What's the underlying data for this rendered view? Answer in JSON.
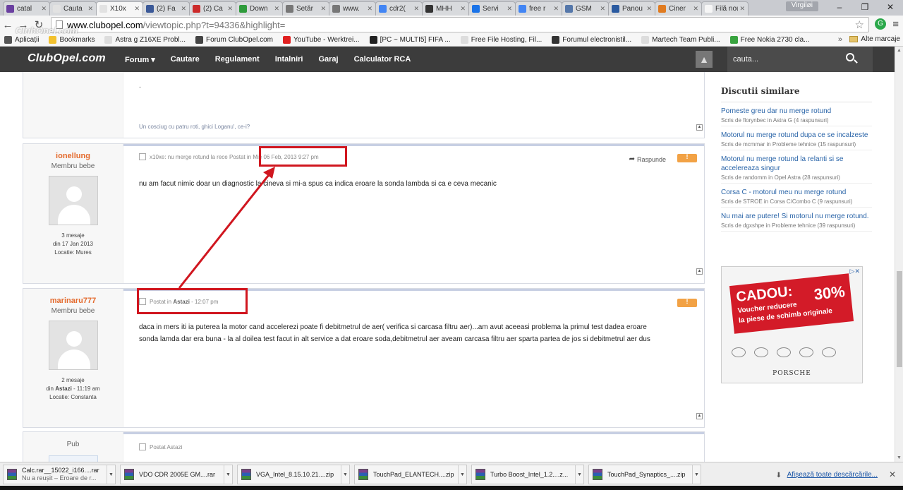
{
  "browser": {
    "tabs": [
      {
        "title": "catal",
        "color": "#6a3fa0"
      },
      {
        "title": "Cauta",
        "color": "#e2e2e2"
      },
      {
        "title": "X10x",
        "color": "#e2e2e2",
        "active": true
      },
      {
        "title": "(2) Fa",
        "color": "#3b5998"
      },
      {
        "title": "(2) Ca",
        "color": "#cc2b2b"
      },
      {
        "title": "Down",
        "color": "#2e9b3b"
      },
      {
        "title": "Setăr",
        "color": "#777777"
      },
      {
        "title": "www.",
        "color": "#777777"
      },
      {
        "title": "cdr2(",
        "color": "#4285f4"
      },
      {
        "title": "MHH",
        "color": "#333333"
      },
      {
        "title": "Servi",
        "color": "#1a73e8"
      },
      {
        "title": "free r",
        "color": "#4285f4"
      },
      {
        "title": "GSM",
        "color": "#5577aa"
      },
      {
        "title": "Panou",
        "color": "#2a5aa0"
      },
      {
        "title": "Ciner",
        "color": "#e07b20"
      },
      {
        "title": "Filă nouă",
        "color": "#f6f6f6"
      }
    ],
    "profile": "Virgiløi",
    "url_host": "www.clubopel.com",
    "url_path": "/viewtopic.php?t=94336&highlight=",
    "watermark": "ClubOpel.com",
    "bookmarks": [
      {
        "label": "Aplicații",
        "color": "#555555"
      },
      {
        "label": "Bookmarks",
        "color": "#f2c12e"
      },
      {
        "label": "Astra g Z16XE Probl...",
        "color": "#dddddd"
      },
      {
        "label": "Forum ClubOpel.com",
        "color": "#444444"
      },
      {
        "label": "YouTube - Werktrei...",
        "color": "#e02020"
      },
      {
        "label": "[PC ~ MULTI5] FIFA ...",
        "color": "#222222"
      },
      {
        "label": "Free File Hosting, Fil...",
        "color": "#dddddd"
      },
      {
        "label": "Forumul electronistil...",
        "color": "#333333"
      },
      {
        "label": "Martech Team Publi...",
        "color": "#dddddd"
      },
      {
        "label": "Free Nokia 2730 cla...",
        "color": "#39a33f"
      }
    ],
    "bookmarks_other": "Alte marcaje"
  },
  "site": {
    "logo": "ClubOpel.com",
    "nav": [
      "Forum ▾",
      "Cautare",
      "Regulament",
      "Intalniri",
      "Garaj",
      "Calculator RCA"
    ],
    "search_placeholder": "cauta..."
  },
  "posts": [
    {
      "text": ".",
      "signature": "Un cosciug cu patru roti, ghici Loganu', ce-i?"
    },
    {
      "username": "ionellung",
      "rank": "Membru bebe",
      "stats": [
        "3 mesaje",
        "din 17 Jan 2013",
        "Locatie: Mures"
      ],
      "meta_prefix": "x10xe: nu merge rotund la rece Postat in",
      "meta_date": "Mie 06 Feb, 2013 9:27 pm",
      "reply_label": "Raspunde",
      "text": "nu am facut nimic doar un diagnostic la cineva si mi-a spus ca indica eroare la sonda lambda si ca e ceva mecanic"
    },
    {
      "username": "marinaru777",
      "rank": "Membru bebe",
      "stats_count": "2 mesaje",
      "stats_joined_prefix": "din",
      "stats_joined_day": "Astazi",
      "stats_joined_time": "- 11:19 am",
      "stats_location": "Locatie: Constanta",
      "meta_prefix": "Postat in",
      "meta_day": "Astazi",
      "meta_time": "- 12:07 pm",
      "text_lines": [
        "daca in mers iti ia puterea la motor cand accelerezi poate fi debitmetrul de aer( verifica si carcasa filtru aer)...am avut aceeasi problema la primul test dadea eroare",
        "sonda lamda dar era buna - la al doilea test facut in alt service a dat eroare soda,debitmetrul aer aveam carcasa filtru aer sparta partea de jos si debitmetrul aer dus"
      ]
    },
    {
      "username": "Pub",
      "meta": "Postat Astazi"
    }
  ],
  "sidebar": {
    "title": "Discutii similare",
    "items": [
      {
        "title": "Porneste greu dar nu merge rotund",
        "meta": "Scris de florynbec in Astra G (4 raspunsuri)"
      },
      {
        "title": "Motorul nu merge rotund dupa ce se incalzeste",
        "meta": "Scris de mcmmar in Probleme tehnice (15 raspunsuri)"
      },
      {
        "title": "Motorul nu merge rotund la relanti si se accelereaza singur",
        "meta": "Scris de randomm in Opel Astra (28 raspunsuri)"
      },
      {
        "title": "Corsa C - motorul meu nu merge rotund",
        "meta": "Scris de STROE in Corsa C/Combo C (9 raspunsuri)"
      },
      {
        "title": "Nu mai are putere! Si motorul nu merge rotund.",
        "meta": "Scris de dgxshpe in Probleme tehnice (39 raspunsuri)"
      }
    ],
    "ad": {
      "headline": "CADOU:",
      "percent": "30%",
      "line1": "Voucher reducere",
      "line2": "la piese de schimb originale",
      "brand": "PORSCHE",
      "brand_row": [
        "VW",
        "Audi",
        "SEAT",
        "ŠKODA",
        "VW Comerciale"
      ]
    }
  },
  "downloads": {
    "items": [
      {
        "name": "Calc.rar__15022_i166....rar",
        "status": "Nu a reușit – Eroare de r..."
      },
      {
        "name": "VDO CDR 2005E GM....rar",
        "status": ""
      },
      {
        "name": "VGA_Intel_8.15.10.21....zip",
        "status": ""
      },
      {
        "name": "TouchPad_ELANTECH....zip",
        "status": ""
      },
      {
        "name": "Turbo Boost_Intel_1.2....z...",
        "status": ""
      },
      {
        "name": "TouchPad_Synaptics_....zip",
        "status": ""
      }
    ],
    "show_all": "Afișează toate descărcările..."
  },
  "colors": {
    "accent_red": "#d0161f",
    "username": "#e46a2d",
    "link": "#2964a8",
    "nav_bg": "#3c3c3c"
  }
}
